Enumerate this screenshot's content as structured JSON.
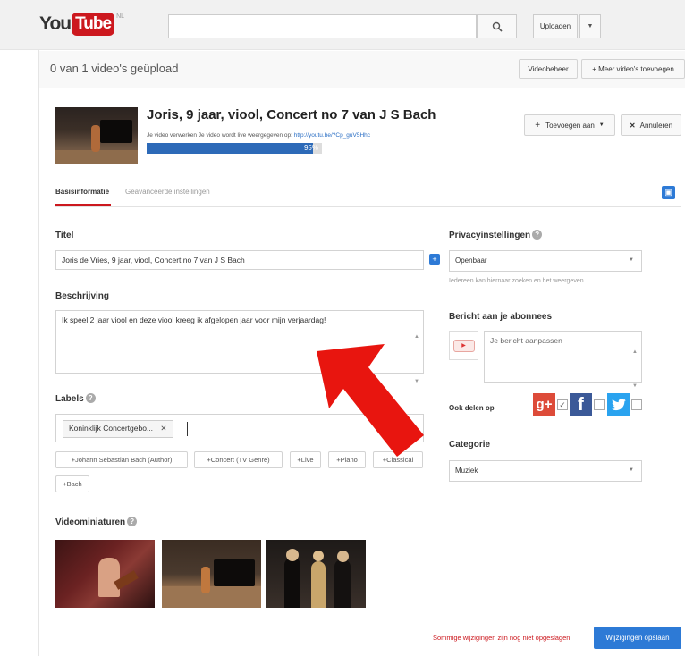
{
  "masthead": {
    "logo_you": "You",
    "logo_tube": "Tube",
    "logo_region": "NL",
    "search_placeholder": "",
    "upload_label": "Uploaden"
  },
  "status": {
    "text": "0 van 1 video's geüpload",
    "videomanager_label": "Videobeheer",
    "more_videos_label": "+ Meer video's toevoegen"
  },
  "upload": {
    "title": "Joris, 9 jaar, viool, Concert no 7 van J S Bach",
    "processing_text": "Je video verwerken Je video wordt live weergegeven op: ",
    "processing_link": "http://youtu.be/?Cp_guV5Hhc",
    "progress": 0.95,
    "progress_label": "95%",
    "add_to_label": "Toevoegen aan",
    "cancel_label": "Annuleren"
  },
  "tabs": {
    "basic": "Basisinformatie",
    "advanced": "Geavanceerde instellingen"
  },
  "form": {
    "title_label": "Titel",
    "title_value": "Joris de Vries, 9 jaar, viool, Concert no 7 van J S  Bach",
    "description_label": "Beschrijving",
    "description_value": "Ik speel 2 jaar viool en deze viool kreeg ik afgelopen jaar voor mijn verjaardag!",
    "labels_label": "Labels",
    "tag": "Koninklijk Concertgebo...",
    "suggestions": [
      "+Johann Sebastian Bach (Author)",
      "+Concert (TV Genre)",
      "+Live",
      "+Piano",
      "+Classical",
      "+Bach"
    ],
    "thumbnails_label": "Videominiaturen"
  },
  "sidebar": {
    "privacy_label": "Privacyinstellingen",
    "privacy_value": "Openbaar",
    "privacy_hint": "Iedereen kan hiernaar zoeken en het weergeven",
    "subscribers_label": "Bericht aan je abonnees",
    "message_placeholder": "Je bericht aanpassen",
    "share_label": "Ook delen op",
    "category_label": "Categorie",
    "category_value": "Muziek"
  },
  "footer": {
    "unsaved_text": "Sommige wijzigingen zijn nog niet opgeslagen",
    "save_label": "Wijzigingen opslaan"
  },
  "colors": {
    "youtube_red": "#cc181e",
    "link_blue": "#2d7ad6",
    "arrow_red": "#e8150f"
  }
}
